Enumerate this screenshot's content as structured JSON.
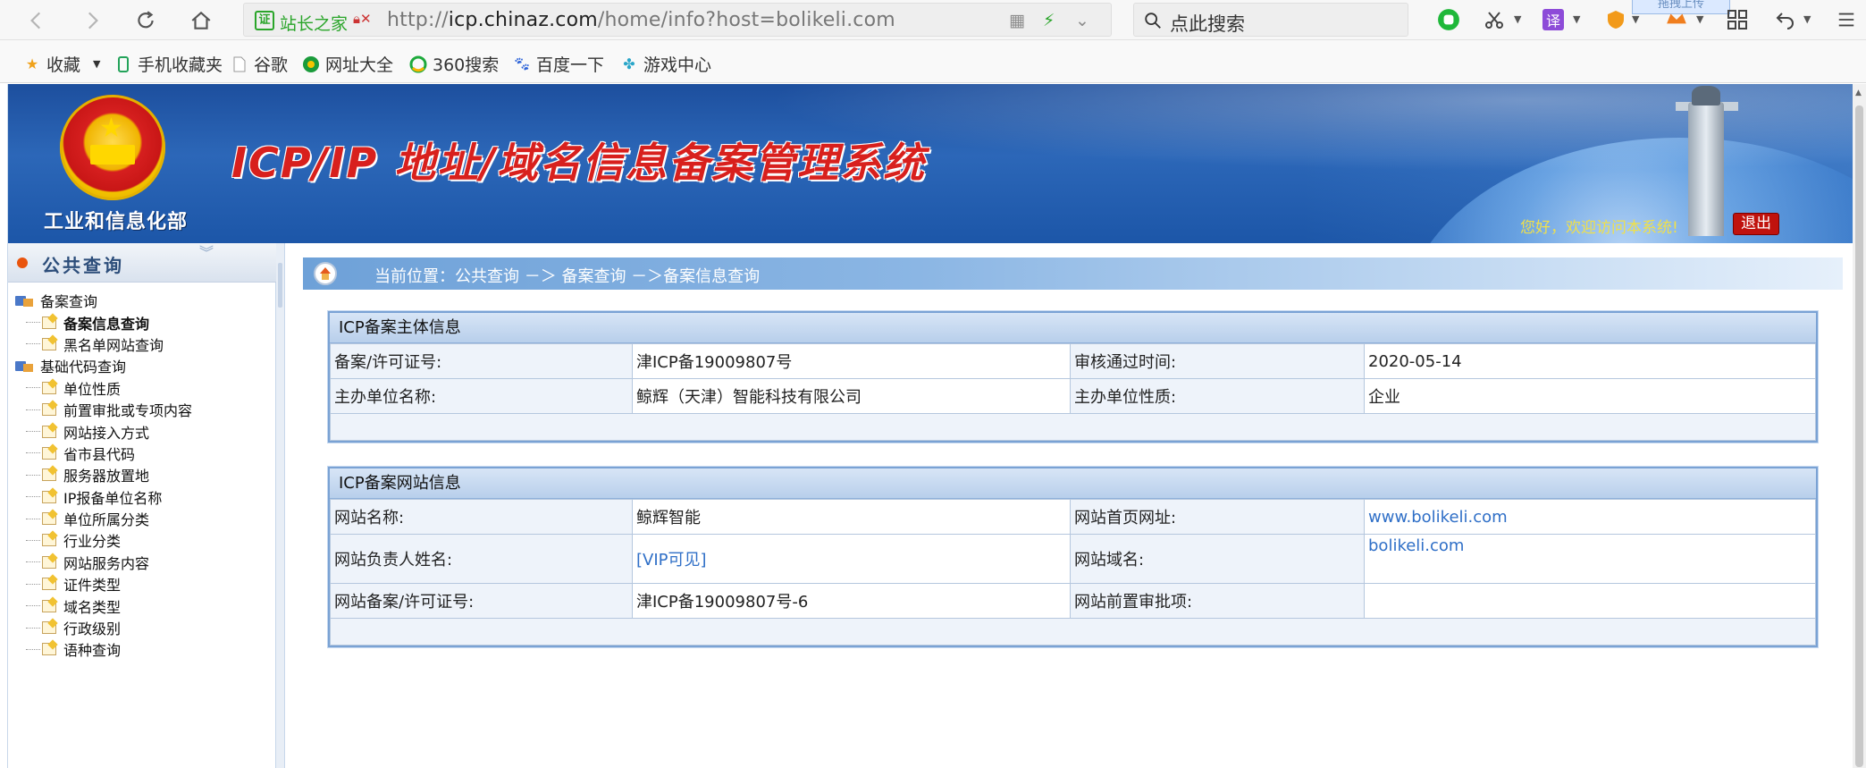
{
  "browser": {
    "site_badge": "站长之家",
    "url_prefix": "http://",
    "url_domain": "icp.chinaz.com",
    "url_path": "/home/info?host=bolikeli.com",
    "search_placeholder": "点此搜索",
    "upload_tip": "拖拽上传",
    "bookmarks": [
      {
        "label": "收藏",
        "icon": "star-icon"
      },
      {
        "label": "手机收藏夹",
        "icon": "phone-icon"
      },
      {
        "label": "谷歌",
        "icon": "page-icon"
      },
      {
        "label": "网址大全",
        "icon": "globe-icon"
      },
      {
        "label": "360搜索",
        "icon": "360-icon"
      },
      {
        "label": "百度一下",
        "icon": "baidu-paw-icon"
      },
      {
        "label": "游戏中心",
        "icon": "gamepad-icon"
      }
    ]
  },
  "header": {
    "ministry": "工业和信息化部",
    "title": "ICP/IP 地址/域名信息备案管理系统",
    "welcome": "您好，欢迎访问本系统!",
    "logout": "退出"
  },
  "sidebar": {
    "title": "公共查询",
    "groups": [
      {
        "label": "备案查询",
        "items": [
          "备案信息查询",
          "黑名单网站查询"
        ]
      },
      {
        "label": "基础代码查询",
        "items": [
          "单位性质",
          "前置审批或专项内容",
          "网站接入方式",
          "省市县代码",
          "服务器放置地",
          "IP报备单位名称",
          "单位所属分类",
          "行业分类",
          "网站服务内容",
          "证件类型",
          "域名类型",
          "行政级别",
          "语种查询"
        ]
      }
    ]
  },
  "breadcrumb": {
    "text": "当前位置：公共查询 －＞ 备案查询 －＞备案信息查询"
  },
  "subject_panel": {
    "title": "ICP备案主体信息",
    "rows": [
      {
        "l1": "备案/许可证号:",
        "v1": "津ICP备19009807号",
        "l2": "审核通过时间:",
        "v2": "2020-05-14"
      },
      {
        "l1": "主办单位名称:",
        "v1": "鲸辉（天津）智能科技有限公司",
        "l2": "主办单位性质:",
        "v2": "企业"
      }
    ]
  },
  "website_panel": {
    "title": "ICP备案网站信息",
    "rows": [
      {
        "l1": "网站名称:",
        "v1": "鲸辉智能",
        "l2": "网站首页网址:",
        "v2": "www.bolikeli.com"
      },
      {
        "l1": "网站负责人姓名:",
        "v1": "[VIP可见]",
        "l2": "网站域名:",
        "v2": "bolikeli.com"
      },
      {
        "l1": "网站备案/许可证号:",
        "v1": "津ICP备19009807号-6",
        "l2": "网站前置审批项:",
        "v2": ""
      }
    ]
  }
}
